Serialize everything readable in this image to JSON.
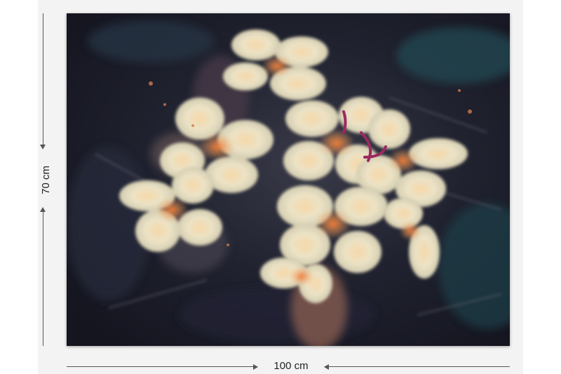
{
  "dimensions": {
    "height_label": "70 cm",
    "width_label": "100 cm"
  },
  "artwork": {
    "subject": "painted-white-flowers-bouquet",
    "colors": {
      "background_dark": "#1b1d2a",
      "background_teal": "#1f3a45",
      "petal_cream": "#eee6c8",
      "flower_center": "#f0914a",
      "accent_magenta": "#9a2a60"
    }
  }
}
